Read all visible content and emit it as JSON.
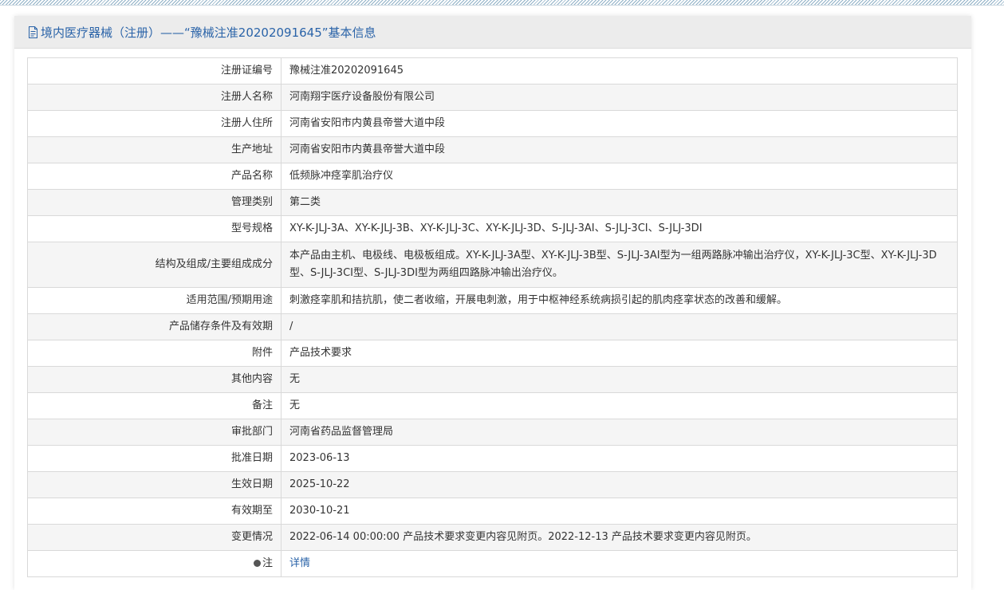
{
  "header": {
    "title": "境内医疗器械（注册）——“豫械注准20202091645”基本信息"
  },
  "rows": [
    {
      "label": "注册证编号",
      "value": "豫械注准20202091645"
    },
    {
      "label": "注册人名称",
      "value": "河南翔宇医疗设备股份有限公司"
    },
    {
      "label": "注册人住所",
      "value": "河南省安阳市内黄县帝誉大道中段"
    },
    {
      "label": "生产地址",
      "value": "河南省安阳市内黄县帝誉大道中段"
    },
    {
      "label": "产品名称",
      "value": "低频脉冲痉挛肌治疗仪"
    },
    {
      "label": "管理类别",
      "value": "第二类"
    },
    {
      "label": "型号规格",
      "value": "XY-K-JLJ-3A、XY-K-JLJ-3B、XY-K-JLJ-3C、XY-K-JLJ-3D、S-JLJ-3AI、S-JLJ-3CI、S-JLJ-3DI"
    },
    {
      "label": "结构及组成/主要组成成分",
      "value": "本产品由主机、电极线、电极板组成。XY-K-JLJ-3A型、XY-K-JLJ-3B型、S-JLJ-3AI型为一组两路脉冲输出治疗仪，XY-K-JLJ-3C型、XY-K-JLJ-3D型、S-JLJ-3CI型、S-JLJ-3DI型为两组四路脉冲输出治疗仪。"
    },
    {
      "label": "适用范围/预期用途",
      "value": "刺激痉挛肌和拮抗肌，使二者收缩，开展电刺激，用于中枢神经系统病损引起的肌肉痉挛状态的改善和缓解。"
    },
    {
      "label": "产品储存条件及有效期",
      "value": "/"
    },
    {
      "label": "附件",
      "value": "产品技术要求"
    },
    {
      "label": "其他内容",
      "value": "无"
    },
    {
      "label": "备注",
      "value": "无"
    },
    {
      "label": "审批部门",
      "value": "河南省药品监督管理局"
    },
    {
      "label": "批准日期",
      "value": "2023-06-13"
    },
    {
      "label": "生效日期",
      "value": "2025-10-22"
    },
    {
      "label": "有效期至",
      "value": "2030-10-21"
    },
    {
      "label": "变更情况",
      "value": "2022-06-14 00:00:00 产品技术要求变更内容见附页。2022-12-13 产品技术要求变更内容见附页。"
    },
    {
      "label": "注",
      "value": "详情"
    }
  ],
  "icons": {
    "header_icon": "document-icon",
    "note_icon": "info-icon"
  },
  "colors": {
    "accent": "#2a63a8",
    "header_bg": "#ececec",
    "row_alt_bg": "#f5f5f5",
    "border": "#d9d9d9"
  }
}
